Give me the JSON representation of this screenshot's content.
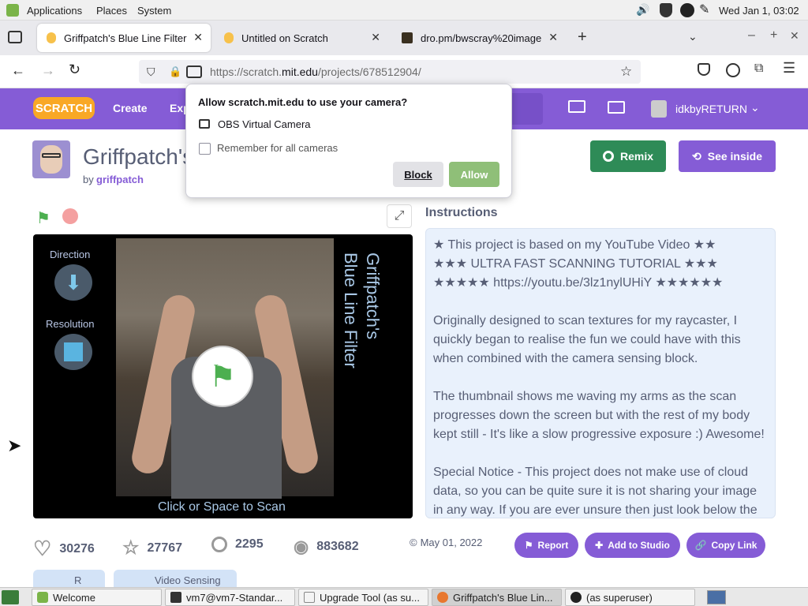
{
  "desktop": {
    "menu": [
      "Applications",
      "Places",
      "System"
    ],
    "clock": "Wed Jan  1, 03:02"
  },
  "browser": {
    "tabs": [
      {
        "title": "Griffpatch's Blue Line Filter",
        "active": true
      },
      {
        "title": "Untitled on Scratch",
        "active": false
      },
      {
        "title": "dro.pm/bwscray%20image",
        "active": false
      }
    ],
    "url_prefix": "https://scratch.",
    "url_domain": "mit.edu",
    "url_path": "/projects/678512904/"
  },
  "permission_popup": {
    "title": "Allow scratch.mit.edu to use your camera?",
    "device": "OBS Virtual Camera",
    "remember_label": "Remember for all cameras",
    "block_label": "Block",
    "allow_label": "Allow"
  },
  "scratch_header": {
    "logo": "SCRATCH",
    "create": "Create",
    "explore_partial": "Exp",
    "username": "idkbyRETURN"
  },
  "project": {
    "title_partial": "Griffpatch's",
    "by_label": "by",
    "author": "griffpatch",
    "remix_label": "Remix",
    "see_inside_label": "See inside",
    "instructions_heading": "Instructions",
    "stage": {
      "direction_label": "Direction",
      "resolution_label": "Resolution",
      "side_title_line1": "Griffpatch's",
      "side_title_line2": "Blue Line Filter",
      "bottom_text": "Click or Space to Scan"
    },
    "instructions": [
      "★ This project is based on my YouTube Video ★★\n★★★ ULTRA FAST SCANNING TUTORIAL ★★★\n★★★★★ https://youtu.be/3lz1nylUHiY ★★★★★★",
      "Originally designed to scan textures for my raycaster, I quickly began to realise the fun we could have with this when combined with the camera sensing block.",
      "The thumbnail shows me waving my arms as the scan progresses down the screen but with the rest of my body kept still - It's like a slow progressive exposure :) Awesome!",
      "Special Notice - This project does not make use of cloud data, so you can be quite sure it is not sharing your image in any way. If you are ever unsure then just look below the"
    ],
    "stats": {
      "loves": "30276",
      "favorites": "27767",
      "remixes": "2295",
      "views": "883682"
    },
    "date": "May 01, 2022",
    "report_label": "Report",
    "add_to_studio_label": "Add to Studio",
    "copy_link_label": "Copy Link",
    "bottom_tab_partial_1": "R",
    "bottom_tab_partial_2": "Video Sensing"
  },
  "taskbar": {
    "tasks": [
      {
        "label": "Welcome"
      },
      {
        "label": "vm7@vm7-Standar..."
      },
      {
        "label": "Upgrade Tool (as su..."
      },
      {
        "label": "Griffpatch's Blue Lin..."
      },
      {
        "label": "(as superuser)"
      }
    ]
  },
  "colors": {
    "scratch_purple": "#855cd6",
    "remix_green": "#2e8b57",
    "allow_green": "#8fbf78",
    "instructions_bg": "#e9f1fc"
  }
}
